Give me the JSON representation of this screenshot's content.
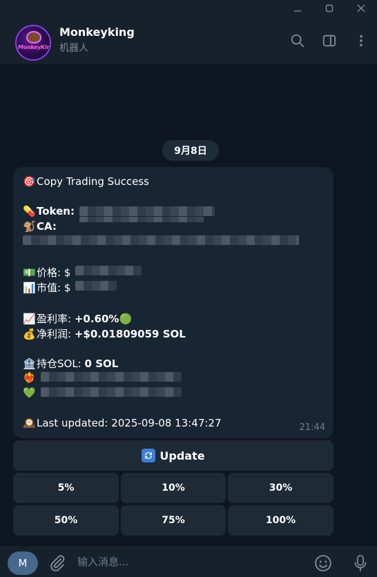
{
  "window": {
    "controls": [
      "minimize",
      "maximize",
      "close"
    ]
  },
  "header": {
    "avatar_text": "MonkeyKing",
    "title": "Monkeyking",
    "subtitle": "机器人"
  },
  "chat": {
    "date": "9月8日",
    "message": {
      "title": "Copy Trading Success",
      "token_label": "Token:",
      "ca_label": "CA:",
      "price_label": "价格: $",
      "mcap_label": "市值: $",
      "pnl_rate_label": "盈利率:",
      "pnl_rate_value": "+0.60%",
      "net_profit_label": "净利润:",
      "net_profit_value": "+$0.01809059 SOL",
      "holding_label": "持仓SOL:",
      "holding_value": "0 SOL",
      "last_updated": "Last updated: 2025-09-08 13:47:27",
      "time": "21:44"
    }
  },
  "keyboard": {
    "update_label": "Update",
    "row1": [
      "5%",
      "10%",
      "30%"
    ],
    "row2": [
      "50%",
      "75%",
      "100%"
    ]
  },
  "composer": {
    "menu_label": "M",
    "placeholder": "输入消息..."
  },
  "colors": {
    "background": "#0e1621",
    "header": "#17212b",
    "bubble": "#182533",
    "button": "#1e2a36",
    "accent": "#46688d"
  }
}
